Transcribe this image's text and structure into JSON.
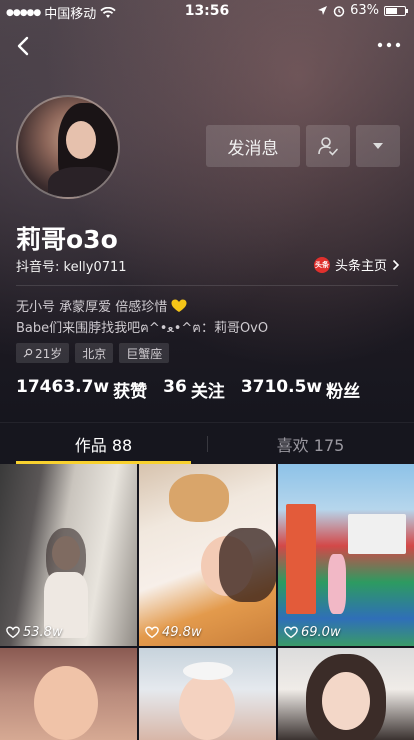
{
  "status_bar": {
    "carrier": "中国移动",
    "time": "13:56",
    "battery": "63%",
    "battery_level": 0.63
  },
  "icons": {
    "back": "chevron-left-icon",
    "more": "more-dots-icon",
    "followed": "user-check-icon",
    "dropdown": "caret-down-icon",
    "location": "location-arrow-icon",
    "alarm": "alarm-icon",
    "wifi": "wifi-icon",
    "heart": "heart-outline-icon"
  },
  "profile": {
    "nickname": "莉哥o3o",
    "douyin_id": "抖音号: kelly0711",
    "toutiao_badge": "头条",
    "toutiao_link": "头条主页",
    "bio_line1": "无小号 承蒙厚爱 倍感珍惜",
    "bio_line2": "Babe们来围脖找我吧ฅ^•ﻌ•^ฅ：莉哥OvO",
    "tags": [
      "21岁",
      "北京",
      "巨蟹座"
    ],
    "stats": [
      {
        "value": "17463.7w",
        "label": "获赞"
      },
      {
        "value": "36",
        "label": "关注"
      },
      {
        "value": "3710.5w",
        "label": "粉丝"
      }
    ]
  },
  "actions": {
    "message_label": "发消息"
  },
  "tabs": [
    {
      "label": "作品 88",
      "active": true
    },
    {
      "label": "喜欢 175",
      "active": false
    }
  ],
  "videos": [
    {
      "likes": "53.8w"
    },
    {
      "likes": "49.8w"
    },
    {
      "likes": "69.0w"
    }
  ],
  "colors": {
    "accent": "#f8d12f",
    "background": "#16161e",
    "toutiao_red": "#e0302d"
  }
}
